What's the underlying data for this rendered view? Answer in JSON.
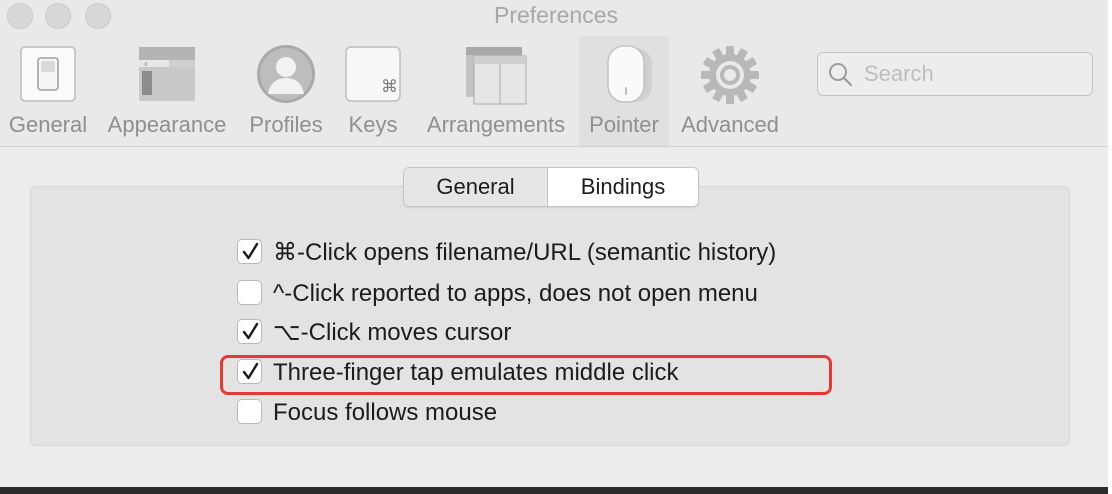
{
  "window": {
    "title": "Preferences"
  },
  "toolbar": {
    "items": [
      {
        "label": "General",
        "icon": "general-switch-icon"
      },
      {
        "label": "Appearance",
        "icon": "appearance-window-icon"
      },
      {
        "label": "Profiles",
        "icon": "profile-person-icon"
      },
      {
        "label": "Keys",
        "icon": "command-key-icon"
      },
      {
        "label": "Arrangements",
        "icon": "arrangement-windows-icon"
      },
      {
        "label": "Pointer",
        "icon": "mouse-icon"
      },
      {
        "label": "Advanced",
        "icon": "gear-icon"
      }
    ],
    "selected": "Pointer"
  },
  "search": {
    "placeholder": "Search",
    "value": ""
  },
  "tabs": {
    "items": [
      "General",
      "Bindings"
    ],
    "selected": "Bindings"
  },
  "options": [
    {
      "label": "⌘-Click opens filename/URL (semantic history)",
      "checked": true
    },
    {
      "label": "^-Click reported to apps, does not open menu",
      "checked": false
    },
    {
      "label": "⌥-Click moves cursor",
      "checked": true
    },
    {
      "label": "Three-finger tap emulates middle click",
      "checked": true
    },
    {
      "label": "Focus follows mouse",
      "checked": false
    }
  ],
  "colors": {
    "highlight": "#e43a31",
    "window_bg": "#ececec",
    "label_gray": "#8f8f8f"
  }
}
